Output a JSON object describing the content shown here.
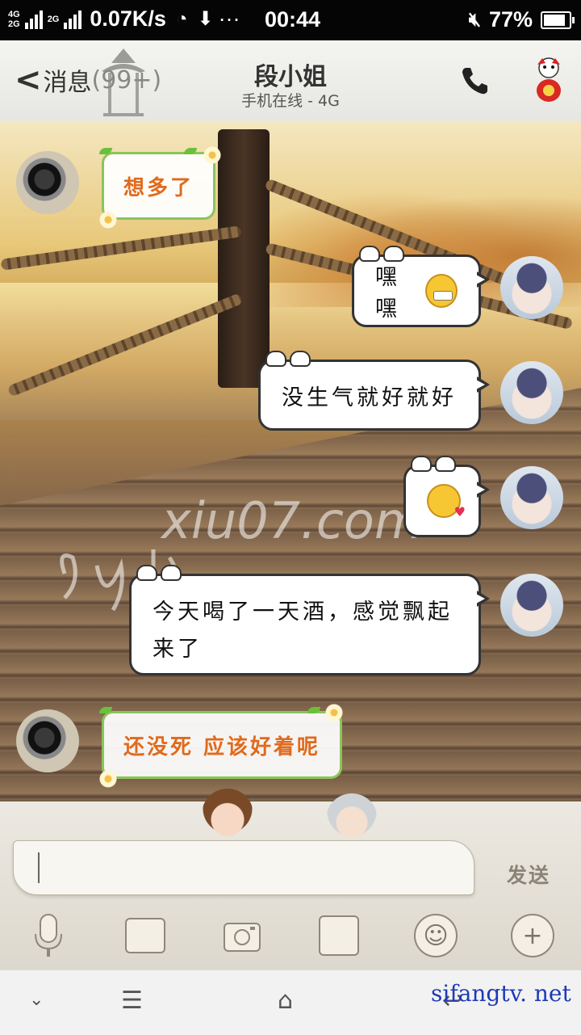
{
  "status_bar": {
    "network_top": "4G",
    "network_bottom": "2G",
    "network_2": "2G",
    "speed": "0.07K/s",
    "extra_icons": "···",
    "time": "00:44",
    "battery_percent": "77%",
    "battery_level": 0.77
  },
  "header": {
    "back_label": "消息",
    "back_count": "(99+)",
    "title": "段小姐",
    "subtitle": "手机在线 - 4G"
  },
  "messages": [
    {
      "side": "in",
      "text": "想多了"
    },
    {
      "side": "out",
      "text": "嘿嘿",
      "emoji": "grinning-face"
    },
    {
      "side": "out",
      "text": "没生气就好就好"
    },
    {
      "side": "out",
      "text": "",
      "emoji": "kissing-face"
    },
    {
      "side": "out",
      "line1": "今天喝了一天酒，感觉飘起",
      "line2": "来了"
    },
    {
      "side": "in",
      "text": "还没死 应该好着呢"
    }
  ],
  "watermark": "xiu07.com",
  "input": {
    "value": "",
    "send_label": "发送"
  },
  "toolbar": [
    "microphone-icon",
    "image-icon",
    "camera-icon",
    "folder-icon",
    "emoji-icon",
    "plus-icon"
  ],
  "navbar": {
    "site_text": "sifangtv. net"
  },
  "colors": {
    "incoming_text": "#e06a1d",
    "incoming_border": "#8cc45c",
    "outgoing_border": "#333333",
    "site_text": "#1d3ab8"
  }
}
